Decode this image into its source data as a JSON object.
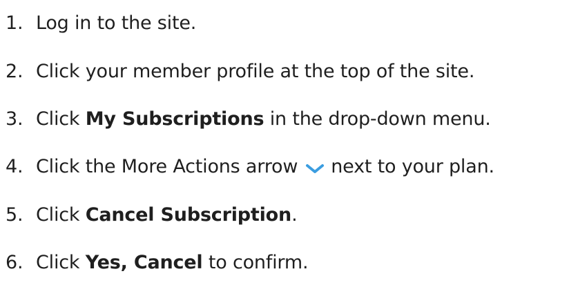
{
  "steps": [
    {
      "number": "1.",
      "text": "Log in to the site."
    },
    {
      "number": "2.",
      "text": "Click your member profile at the top of the site."
    },
    {
      "number": "3.",
      "before": "Click ",
      "bold": "My Subscriptions",
      "after": " in the drop-down menu."
    },
    {
      "number": "4.",
      "before": "Click the More Actions arrow",
      "icon": "chevron-down-icon",
      "after": "next to your plan."
    },
    {
      "number": "5.",
      "before": "Click ",
      "bold": "Cancel Subscription",
      "after": "."
    },
    {
      "number": "6.",
      "before": "Click ",
      "bold": "Yes, Cancel",
      "after": " to confirm."
    }
  ],
  "colors": {
    "text": "#1f1f1f",
    "chevron": "#3b9de0"
  }
}
